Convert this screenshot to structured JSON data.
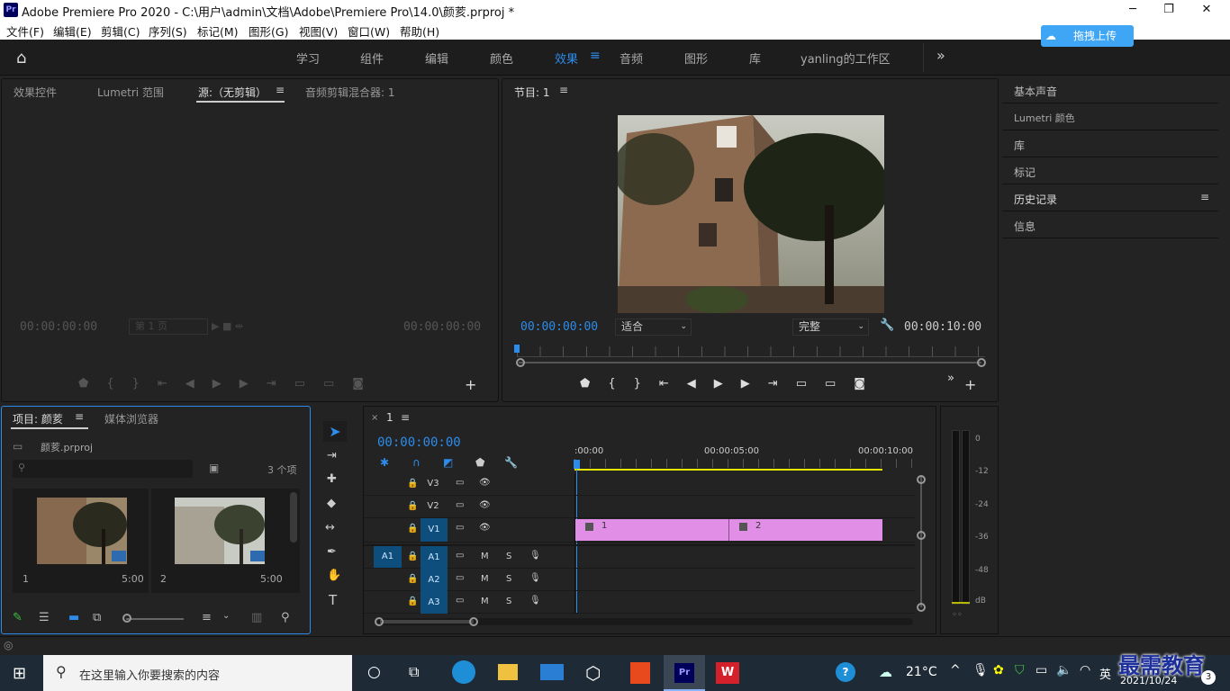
{
  "window": {
    "title": "Adobe Premiere Pro 2020 - C:\\用户\\admin\\文档\\Adobe\\Premiere Pro\\14.0\\颜荄.prproj *",
    "app_icon": "Pr",
    "upload_label": "拖拽上传"
  },
  "menu": [
    "文件(F)",
    "编辑(E)",
    "剪辑(C)",
    "序列(S)",
    "标记(M)",
    "图形(G)",
    "视图(V)",
    "窗口(W)",
    "帮助(H)"
  ],
  "workspaces": [
    "学习",
    "组件",
    "编辑",
    "颜色",
    "效果",
    "音频",
    "图形",
    "库",
    "yanling的工作区"
  ],
  "active_workspace": "效果",
  "source": {
    "tabs": [
      "效果控件",
      "Lumetri 范围",
      "源:（无剪辑）",
      "音频剪辑混合器: 1"
    ],
    "active_tab": "源:（无剪辑）",
    "tc_left": "00:00:00:00",
    "tc_right": "00:00:00:00",
    "page": "第 1 页"
  },
  "program": {
    "tab": "节目: 1",
    "tc_left": "00:00:00:00",
    "fit": "适合",
    "quality": "完整",
    "tc_right": "00:00:10:00"
  },
  "right_panels": [
    "基本声音",
    "Lumetri 颜色",
    "库",
    "标记",
    "历史记录",
    "信息"
  ],
  "project": {
    "tabs": [
      "项目: 颜荄",
      "媒体浏览器"
    ],
    "file": "颜荄.prproj",
    "count": "3 个项",
    "clips": [
      {
        "name": "1",
        "dur": "5:00"
      },
      {
        "name": "2",
        "dur": "5:00"
      }
    ]
  },
  "timeline": {
    "tab": "1",
    "tc": "00:00:00:00",
    "ruler": [
      ":00:00",
      "00:00:05:00",
      "00:00:10:00"
    ],
    "video_tracks": [
      "V3",
      "V2",
      "V1"
    ],
    "audio_tracks": [
      "A1",
      "A2",
      "A3"
    ],
    "source_patch": "A1",
    "clips": [
      "1",
      "2"
    ],
    "audio_buttons": [
      "M",
      "S"
    ]
  },
  "meter": {
    "scale": [
      "0",
      "-12",
      "-24",
      "-36",
      "-48",
      "dB"
    ],
    "footer": "◦◦"
  },
  "taskbar": {
    "search": "在这里输入你要搜索的内容",
    "weather": "21°C",
    "lang": "英",
    "date": "2021/10/24",
    "watermark": "最需教育",
    "badge": "3"
  },
  "colors": {
    "accent": "#2d8ceb",
    "clip": "#e18fe6",
    "panel": "#232323"
  }
}
